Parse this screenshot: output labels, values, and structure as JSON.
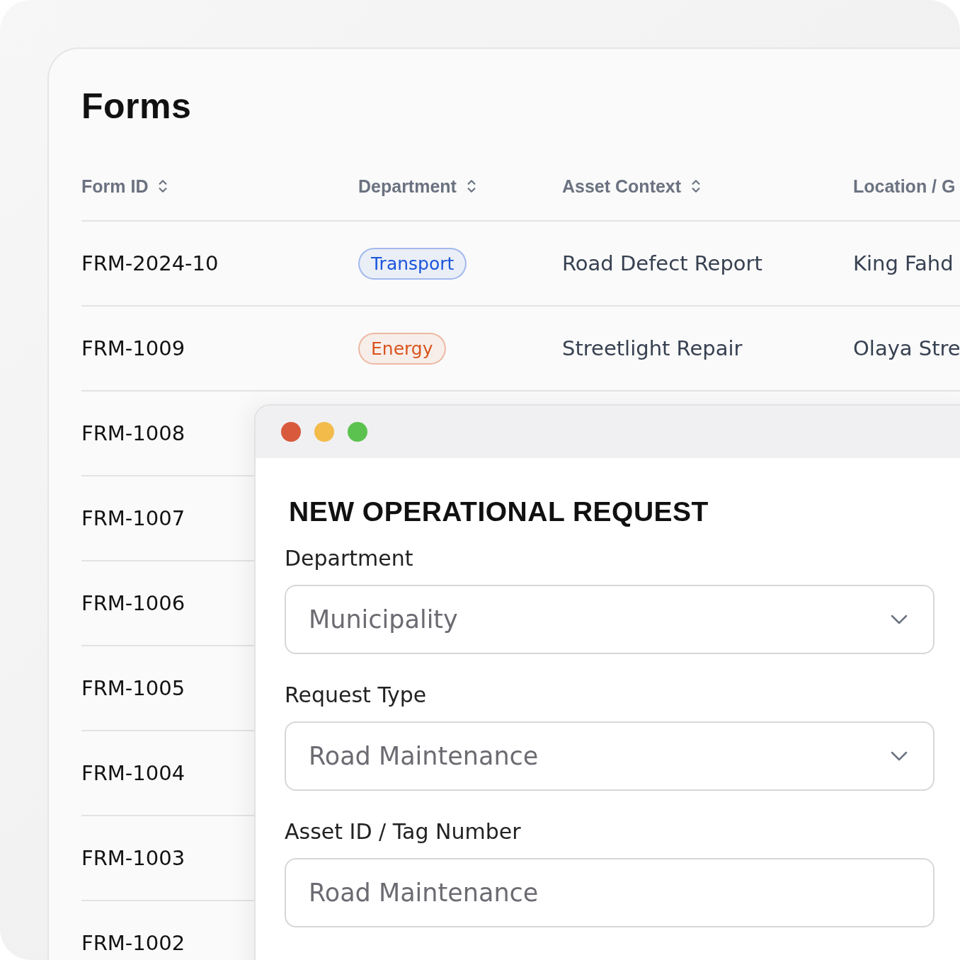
{
  "page": {
    "title": "Forms"
  },
  "table": {
    "columns": [
      {
        "label": "Form ID",
        "sortable": true
      },
      {
        "label": "Department",
        "sortable": true
      },
      {
        "label": "Asset Context",
        "sortable": true
      },
      {
        "label": "Location / G"
      }
    ],
    "rows": [
      {
        "form_id": "FRM-2024-10",
        "department": {
          "label": "Transport",
          "color": "#1a56db"
        },
        "asset_context": "Road Defect Report",
        "location": "King Fahd"
      },
      {
        "form_id": "FRM-1009",
        "department": {
          "label": "Energy",
          "color": "#d9541e"
        },
        "asset_context": "Streetlight Repair",
        "location": "Olaya Stre"
      },
      {
        "form_id": "FRM-1008"
      },
      {
        "form_id": "FRM-1007"
      },
      {
        "form_id": "FRM-1006"
      },
      {
        "form_id": "FRM-1005"
      },
      {
        "form_id": "FRM-1004"
      },
      {
        "form_id": "FRM-1003"
      },
      {
        "form_id": "FRM-1002"
      }
    ]
  },
  "dialog": {
    "title": "NEW OPERATIONAL REQUEST",
    "fields": [
      {
        "label": "Department",
        "value": "Municipality",
        "kind": "select"
      },
      {
        "label": "Request Type",
        "value": "Road Maintenance",
        "kind": "select"
      },
      {
        "label": "Asset ID / Tag Number",
        "value": "Road Maintenance",
        "kind": "text"
      }
    ]
  }
}
